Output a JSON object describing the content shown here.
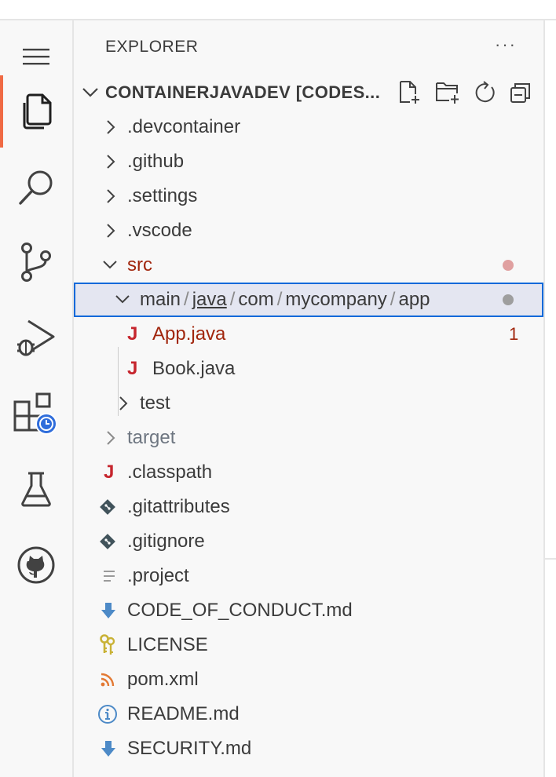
{
  "sidebar": {
    "title": "EXPLORER",
    "more_label": "···",
    "section_title": "CONTAINERJAVADEV [CODES..."
  },
  "tree": {
    "devcontainer": ".devcontainer",
    "github": ".github",
    "settings": ".settings",
    "vscode": ".vscode",
    "src": "src",
    "path": {
      "main": "main",
      "slash": "/",
      "java": "java",
      "com": "com",
      "mycompany": "mycompany",
      "app": "app"
    },
    "app_java": "App.java",
    "app_java_badge": "1",
    "book_java": "Book.java",
    "test": "test",
    "target": "target",
    "classpath": ".classpath",
    "gitattributes": ".gitattributes",
    "gitignore": ".gitignore",
    "project": ".project",
    "code_of_conduct": "CODE_OF_CONDUCT.md",
    "license": "LICENSE",
    "pom": "pom.xml",
    "readme": "README.md",
    "security": "SECURITY.md"
  },
  "icons": {
    "java_glyph": "J",
    "menu": "menu-icon",
    "explorer": "files-icon",
    "search": "search-icon",
    "scm": "source-control-icon",
    "debug": "run-debug-icon",
    "extensions": "remote-explorer-icon",
    "testing": "testing-flask-icon",
    "github": "github-icon"
  },
  "colors": {
    "accent_active": "#f06a44",
    "error_red": "#a1260d",
    "selection_border": "#0969da",
    "selection_bg": "#e4e6f1",
    "java_red": "#c6262e",
    "markdown_blue": "#4d8ac7",
    "modified_dot_red": "#e0a0a0",
    "modified_dot_grey": "#9e9e9e",
    "badge_blue": "#2f6ddb"
  }
}
